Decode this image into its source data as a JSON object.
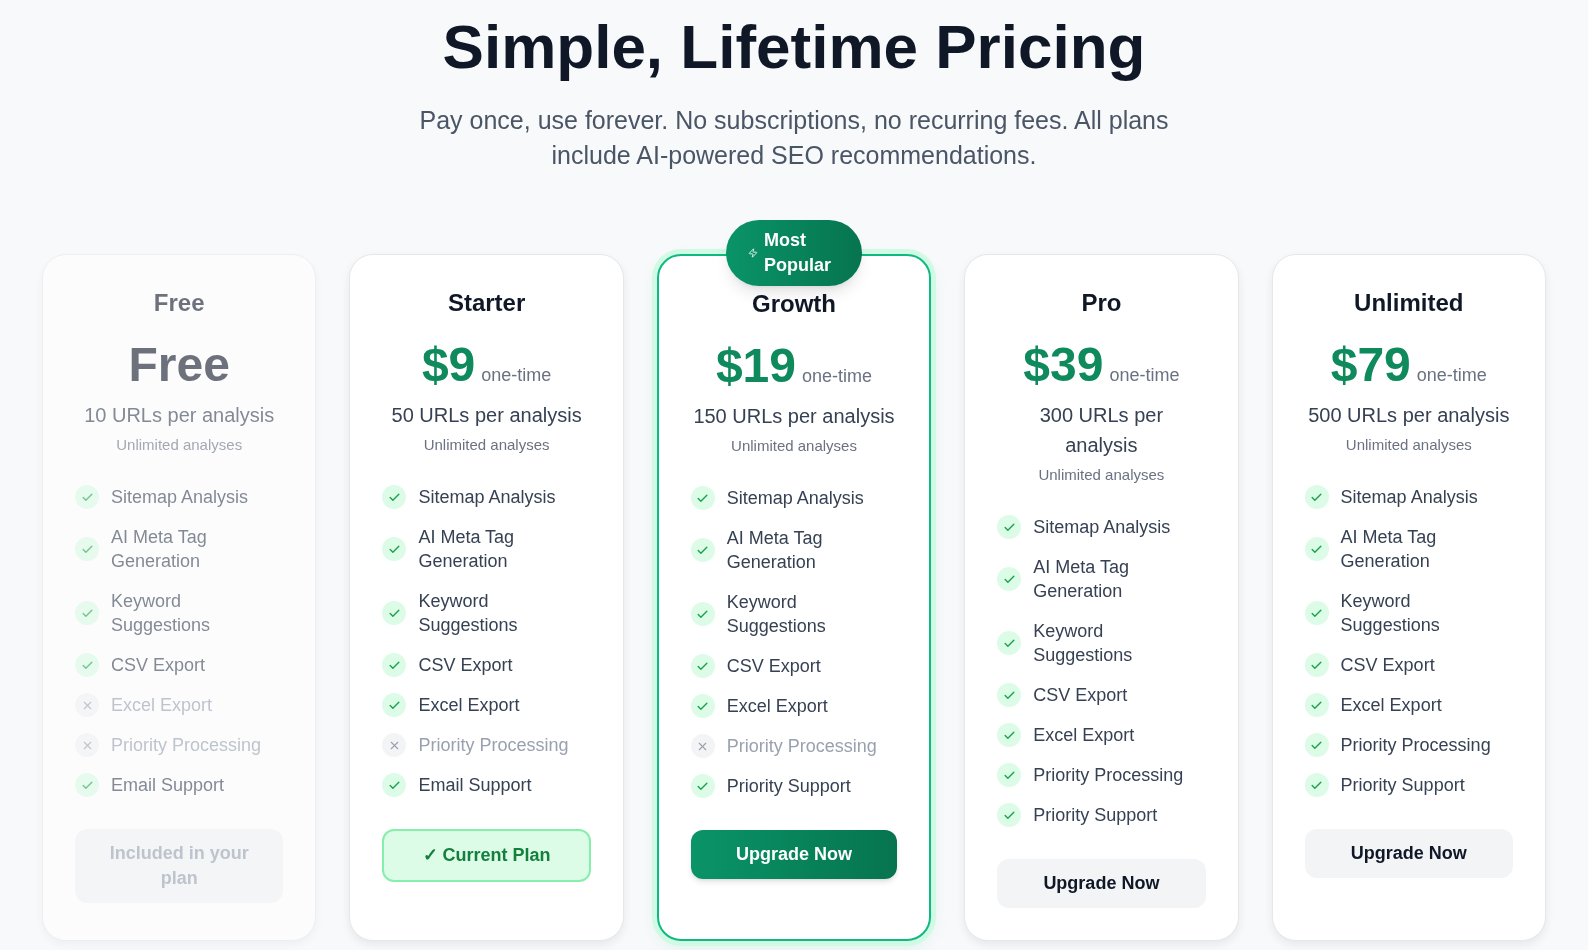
{
  "header": {
    "title": "Simple, Lifetime Pricing",
    "subtitle": "Pay once, use forever. No subscriptions, no recurring fees. All plans include AI-powered SEO recommendations."
  },
  "plans": [
    {
      "name": "Free",
      "price": "Free",
      "disabled": true,
      "highlighted": false,
      "urls": "10 URLs per analysis",
      "analyses": "Unlimited analyses",
      "features": [
        {
          "label": "Sitemap Analysis",
          "included": true
        },
        {
          "label": "AI Meta Tag Generation",
          "included": true
        },
        {
          "label": "Keyword Suggestions",
          "included": true
        },
        {
          "label": "CSV Export",
          "included": true
        },
        {
          "label": "Excel Export",
          "included": false
        },
        {
          "label": "Priority Processing",
          "included": false
        },
        {
          "label": "Email Support",
          "included": true
        }
      ],
      "button": {
        "label": "Included in your plan",
        "kind": "included"
      }
    },
    {
      "name": "Starter",
      "price": "$9",
      "period": "one-time",
      "disabled": false,
      "highlighted": false,
      "urls": "50 URLs per analysis",
      "analyses": "Unlimited analyses",
      "features": [
        {
          "label": "Sitemap Analysis",
          "included": true
        },
        {
          "label": "AI Meta Tag Generation",
          "included": true
        },
        {
          "label": "Keyword Suggestions",
          "included": true
        },
        {
          "label": "CSV Export",
          "included": true
        },
        {
          "label": "Excel Export",
          "included": true
        },
        {
          "label": "Priority Processing",
          "included": false
        },
        {
          "label": "Email Support",
          "included": true
        }
      ],
      "button": {
        "label": "✓ Current Plan",
        "kind": "current"
      }
    },
    {
      "name": "Growth",
      "badge": "Most Popular",
      "price": "$19",
      "period": "one-time",
      "disabled": false,
      "highlighted": true,
      "urls": "150 URLs per analysis",
      "analyses": "Unlimited analyses",
      "features": [
        {
          "label": "Sitemap Analysis",
          "included": true
        },
        {
          "label": "AI Meta Tag Generation",
          "included": true
        },
        {
          "label": "Keyword Suggestions",
          "included": true
        },
        {
          "label": "CSV Export",
          "included": true
        },
        {
          "label": "Excel Export",
          "included": true
        },
        {
          "label": "Priority Processing",
          "included": false
        },
        {
          "label": "Priority Support",
          "included": true
        }
      ],
      "button": {
        "label": "Upgrade Now",
        "kind": "primary"
      }
    },
    {
      "name": "Pro",
      "price": "$39",
      "period": "one-time",
      "disabled": false,
      "highlighted": false,
      "urls": "300 URLs per analysis",
      "analyses": "Unlimited analyses",
      "features": [
        {
          "label": "Sitemap Analysis",
          "included": true
        },
        {
          "label": "AI Meta Tag Generation",
          "included": true
        },
        {
          "label": "Keyword Suggestions",
          "included": true
        },
        {
          "label": "CSV Export",
          "included": true
        },
        {
          "label": "Excel Export",
          "included": true
        },
        {
          "label": "Priority Processing",
          "included": true
        },
        {
          "label": "Priority Support",
          "included": true
        }
      ],
      "button": {
        "label": "Upgrade Now",
        "kind": "secondary"
      }
    },
    {
      "name": "Unlimited",
      "price": "$79",
      "period": "one-time",
      "disabled": false,
      "highlighted": false,
      "urls": "500 URLs per analysis",
      "analyses": "Unlimited analyses",
      "features": [
        {
          "label": "Sitemap Analysis",
          "included": true
        },
        {
          "label": "AI Meta Tag Generation",
          "included": true
        },
        {
          "label": "Keyword Suggestions",
          "included": true
        },
        {
          "label": "CSV Export",
          "included": true
        },
        {
          "label": "Excel Export",
          "included": true
        },
        {
          "label": "Priority Processing",
          "included": true
        },
        {
          "label": "Priority Support",
          "included": true
        }
      ],
      "button": {
        "label": "Upgrade Now",
        "kind": "secondary"
      }
    }
  ]
}
